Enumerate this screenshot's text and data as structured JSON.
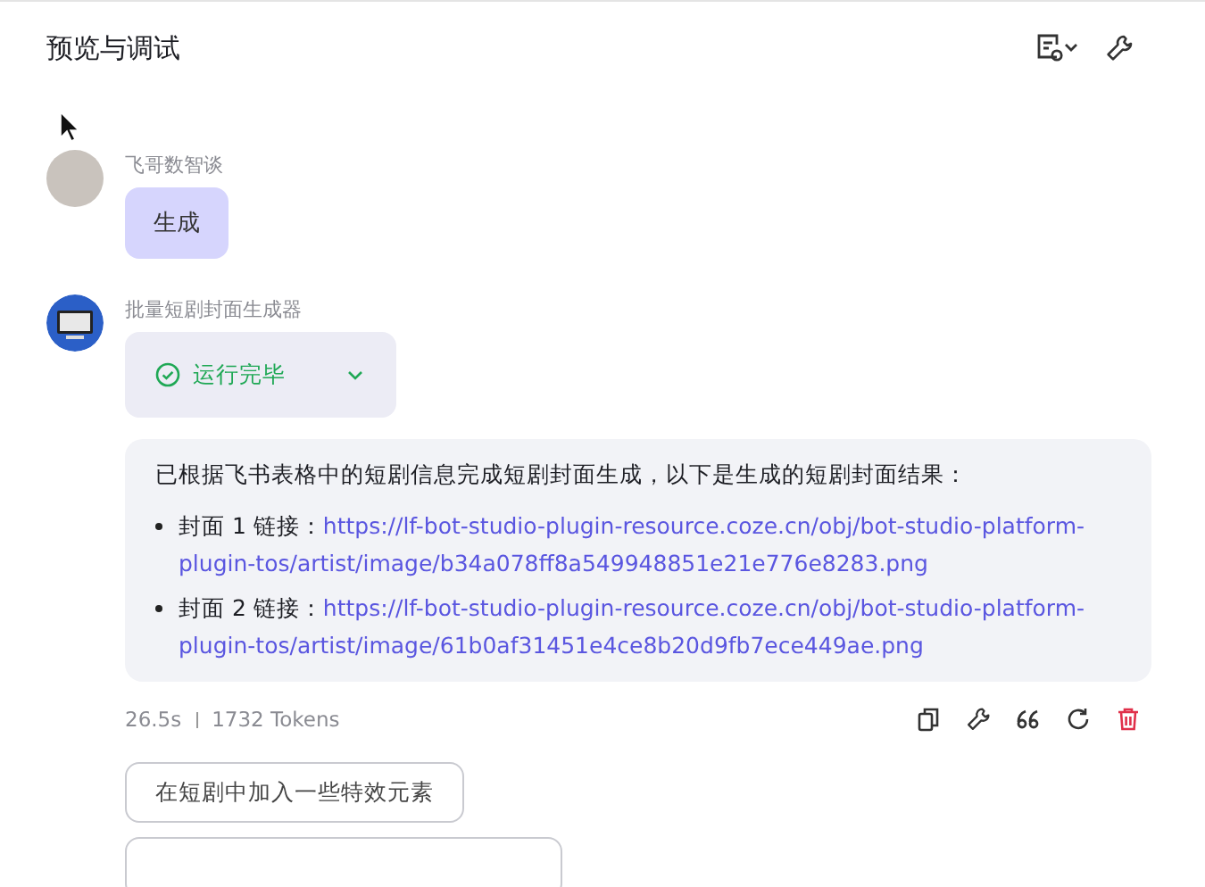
{
  "header": {
    "title": "预览与调试"
  },
  "messages": [
    {
      "kind": "user",
      "sender": "飞哥数智谈",
      "text": "生成"
    },
    {
      "kind": "bot",
      "sender": "批量短剧封面生成器",
      "status": {
        "label": "运行完毕",
        "expanded": false
      },
      "intro": "已根据飞书表格中的短剧信息完成短剧封面生成，以下是生成的短剧封面结果：",
      "items": [
        {
          "label": "封面 1 链接：",
          "link": "https://lf-bot-studio-plugin-resource.coze.cn/obj/bot-studio-platform-plugin-tos/artist/image/b34a078ff8a549948851e21e776e8283.png"
        },
        {
          "label": "封面 2 链接：",
          "link": "https://lf-bot-studio-plugin-resource.coze.cn/obj/bot-studio-platform-plugin-tos/artist/image/61b0af31451e4ce8b20d9fb7ece449ae.png"
        }
      ],
      "duration": "26.5s",
      "tokens": "1732 Tokens"
    }
  ],
  "suggestions": [
    {
      "kind": "full",
      "text": "在短剧中加入一些特效元素"
    },
    {
      "kind": "cut"
    }
  ]
}
